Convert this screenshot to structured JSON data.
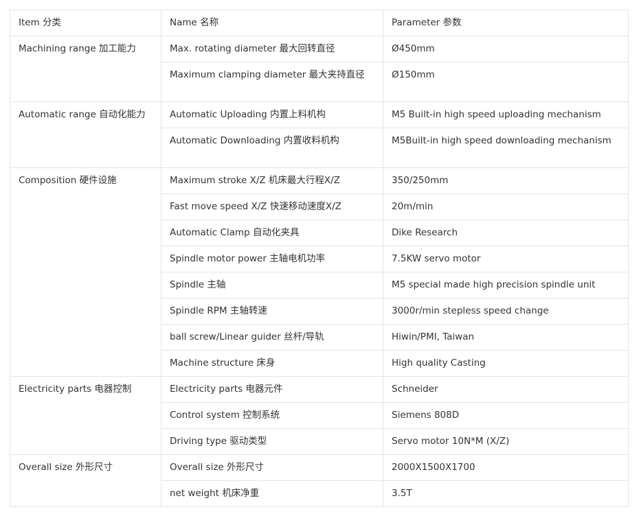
{
  "header": {
    "item": "Item 分类",
    "name": "Name 名称",
    "parameter": "Parameter 参数"
  },
  "groups": [
    {
      "category": "Machining range  加工能力",
      "rows": [
        {
          "name": "Max. rotating diameter  最大回转直径",
          "value": "Ø450mm"
        },
        {
          "name": "Maximum clamping diameter  最大夹持直径",
          "value": "Ø150mm"
        }
      ]
    },
    {
      "category": "Automatic range  自动化能力",
      "rows": [
        {
          "name": "Automatic Uploading  内置上料机构",
          "value": "M5 Built-in high speed uploading mechanism"
        },
        {
          "name": "Automatic Downloading  内置收料机构",
          "value": "M5Built-in high speed downloading mechanism"
        }
      ]
    },
    {
      "category": "Composition  硬件设施",
      "rows": [
        {
          "name": "Maximum stroke X/Z  机床最大行程X/Z",
          "value": "350/250mm"
        },
        {
          "name": "Fast move speed X/Z  快速移动速度X/Z",
          "value": "20m/min"
        },
        {
          "name": "Automatic Clamp  自动化夹具",
          "value": "Dike Research"
        },
        {
          "name": "Spindle motor power  主轴电机功率",
          "value": "7.5KW servo motor"
        },
        {
          "name": "Spindle  主轴",
          "value": "M5 special made high precision spindle unit"
        },
        {
          "name": "Spindle RPM  主轴转速",
          "value": "3000r/min stepless speed change"
        },
        {
          "name": "ball screw/Linear guider   丝杆/导轨",
          "value": "Hiwin/PMI, Taiwan"
        },
        {
          "name": "Machine structure  床身",
          "value": "High quality Casting"
        }
      ]
    },
    {
      "category": "Electricity parts  电器控制",
      "rows": [
        {
          "name": "Electricity parts  电器元件",
          "value": "Schneider"
        },
        {
          "name": "Control system  控制系统",
          "value": "Siemens 808D"
        },
        {
          "name": "Driving type  驱动类型",
          "value": "Servo motor 10N*M    (X/Z)"
        }
      ]
    },
    {
      "category": "Overall size  外形尺寸",
      "rows": [
        {
          "name": "Overall size  外形尺寸",
          "value": "2000X1500X1700"
        },
        {
          "name": "net weight  机床净重",
          "value": "3.5T"
        }
      ]
    }
  ]
}
